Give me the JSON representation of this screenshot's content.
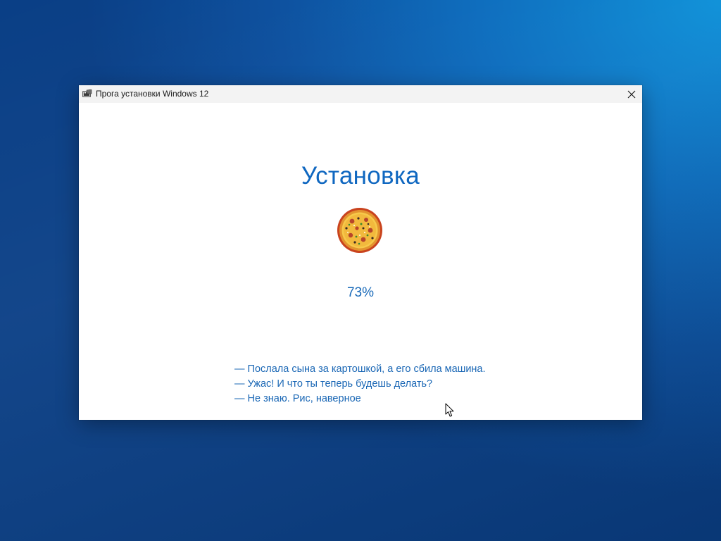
{
  "window": {
    "title": "Прога установки Windows 12",
    "app_icon": "windows-installer-icon",
    "close_icon": "close-icon"
  },
  "main": {
    "heading": "Установка",
    "progress_icon": "pizza-icon",
    "progress_text": "73%",
    "progress_value": 0.73
  },
  "dialog": {
    "lines": [
      "— Послала сына за картошкой, а его сбила машина.",
      "— Ужас! И что ты теперь будешь делать?",
      "— Не знаю. Рис, наверное"
    ]
  },
  "colors": {
    "accent": "#0f67c0",
    "text_accent": "#1a67b5",
    "titlebar": "#f3f3f3",
    "desktop": "#0b5aa8"
  }
}
